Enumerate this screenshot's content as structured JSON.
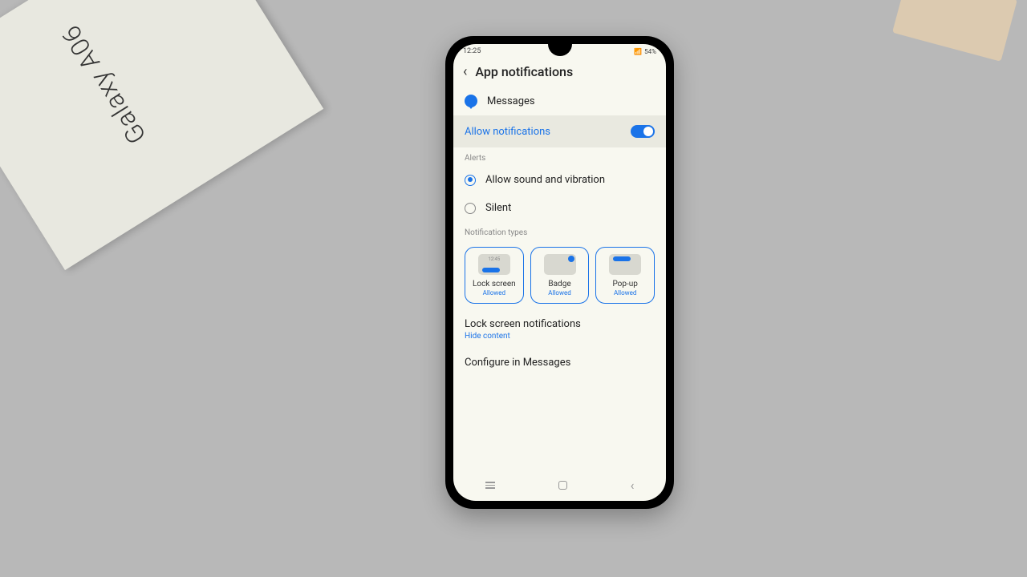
{
  "status": {
    "time": "12:25",
    "battery": "54%"
  },
  "header": {
    "title": "App notifications"
  },
  "app": {
    "name": "Messages"
  },
  "allow": {
    "label": "Allow notifications",
    "enabled": true
  },
  "sections": {
    "alerts_label": "Alerts",
    "types_label": "Notification types"
  },
  "alerts": {
    "sound_label": "Allow sound and vibration",
    "silent_label": "Silent",
    "selected": "sound"
  },
  "types": [
    {
      "label": "Lock screen",
      "status": "Allowed"
    },
    {
      "label": "Badge",
      "status": "Allowed"
    },
    {
      "label": "Pop-up",
      "status": "Allowed"
    }
  ],
  "lockscreen": {
    "title": "Lock screen notifications",
    "sub": "Hide content"
  },
  "configure": {
    "title": "Configure in Messages"
  },
  "background": {
    "box_label": "Galaxy A06"
  }
}
